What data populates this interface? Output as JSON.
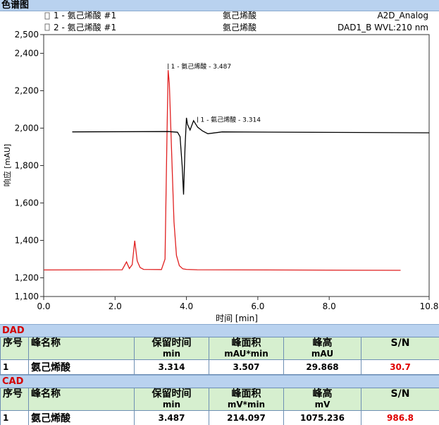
{
  "window": {
    "title": "色谱图"
  },
  "legend": {
    "trace1": {
      "name": "1 - 氨己烯酸 #1",
      "compound": "氨己烯酸",
      "channel": "A2D_Analog",
      "color": "#e02020"
    },
    "trace2": {
      "name": "2 - 氨己烯酸 #1",
      "compound": "氨己烯酸",
      "channel": "DAD1_B WVL:210 nm",
      "color": "#000000"
    }
  },
  "chart_data": {
    "type": "line",
    "xlabel": "时间 [min]",
    "ylabel": "响应 [mAU]",
    "xlim": [
      0,
      10.8
    ],
    "ylim": [
      1100,
      2500
    ],
    "x_ticks": [
      "0.0",
      "2.0",
      "4.0",
      "6.0",
      "8.0",
      "10.8"
    ],
    "y_ticks": [
      "1,100",
      "1,200",
      "1,400",
      "1,600",
      "1,800",
      "2,000",
      "2,200",
      "2,400",
      "2,500"
    ],
    "grid": false,
    "series": [
      {
        "name": "1 - 氨己烯酸 #1",
        "color": "#e02020",
        "x": [
          0.0,
          2.2,
          2.32,
          2.4,
          2.48,
          2.55,
          2.62,
          2.7,
          2.8,
          3.3,
          3.4,
          3.45,
          3.487,
          3.52,
          3.58,
          3.65,
          3.72,
          3.8,
          3.9,
          4.0,
          4.3,
          10.0
        ],
        "y": [
          1242,
          1243,
          1285,
          1250,
          1270,
          1398,
          1290,
          1255,
          1245,
          1244,
          1300,
          1900,
          2310,
          2240,
          1900,
          1500,
          1320,
          1265,
          1248,
          1245,
          1243,
          1240
        ]
      },
      {
        "name": "2 - 氨己烯酸 #1",
        "color": "#000000",
        "x": [
          0.8,
          3.5,
          3.75,
          3.82,
          3.88,
          3.92,
          3.96,
          4.0,
          4.03,
          4.1,
          4.2,
          4.314,
          4.45,
          4.6,
          5.0,
          10.8
        ],
        "y": [
          1980,
          1982,
          1978,
          1955,
          1800,
          1645,
          1900,
          2055,
          2020,
          1990,
          2040,
          2005,
          1985,
          1970,
          1980,
          1975
        ]
      }
    ],
    "annotations": [
      {
        "text": "1 - 氨己烯酸 - 3.487",
        "x": 3.487,
        "y": 2330
      },
      {
        "text": "1 - 氨己烯酸 - 3.314",
        "x": 4.314,
        "y": 2045
      }
    ]
  },
  "dad_table": {
    "title": "DAD",
    "headers": [
      {
        "l1": "序号",
        "l2": ""
      },
      {
        "l1": "峰名称",
        "l2": ""
      },
      {
        "l1": "保留时间",
        "l2": "min"
      },
      {
        "l1": "峰面积",
        "l2": "mAU*min"
      },
      {
        "l1": "峰高",
        "l2": "mAU"
      },
      {
        "l1": "S/N",
        "l2": ""
      }
    ],
    "row": {
      "no": "1",
      "name": "氨己烯酸",
      "rt": "3.314",
      "area": "3.507",
      "height": "29.868",
      "sn": "30.7"
    }
  },
  "cad_table": {
    "title": "CAD",
    "headers": [
      {
        "l1": "序号",
        "l2": ""
      },
      {
        "l1": "峰名称",
        "l2": ""
      },
      {
        "l1": "保留时间",
        "l2": "min"
      },
      {
        "l1": "峰面积",
        "l2": "mV*min"
      },
      {
        "l1": "峰高",
        "l2": "mV"
      },
      {
        "l1": "S/N",
        "l2": ""
      }
    ],
    "row": {
      "no": "1",
      "name": "氨己烯酸",
      "rt": "3.487",
      "area": "214.097",
      "height": "1075.236",
      "sn": "986.8"
    }
  }
}
